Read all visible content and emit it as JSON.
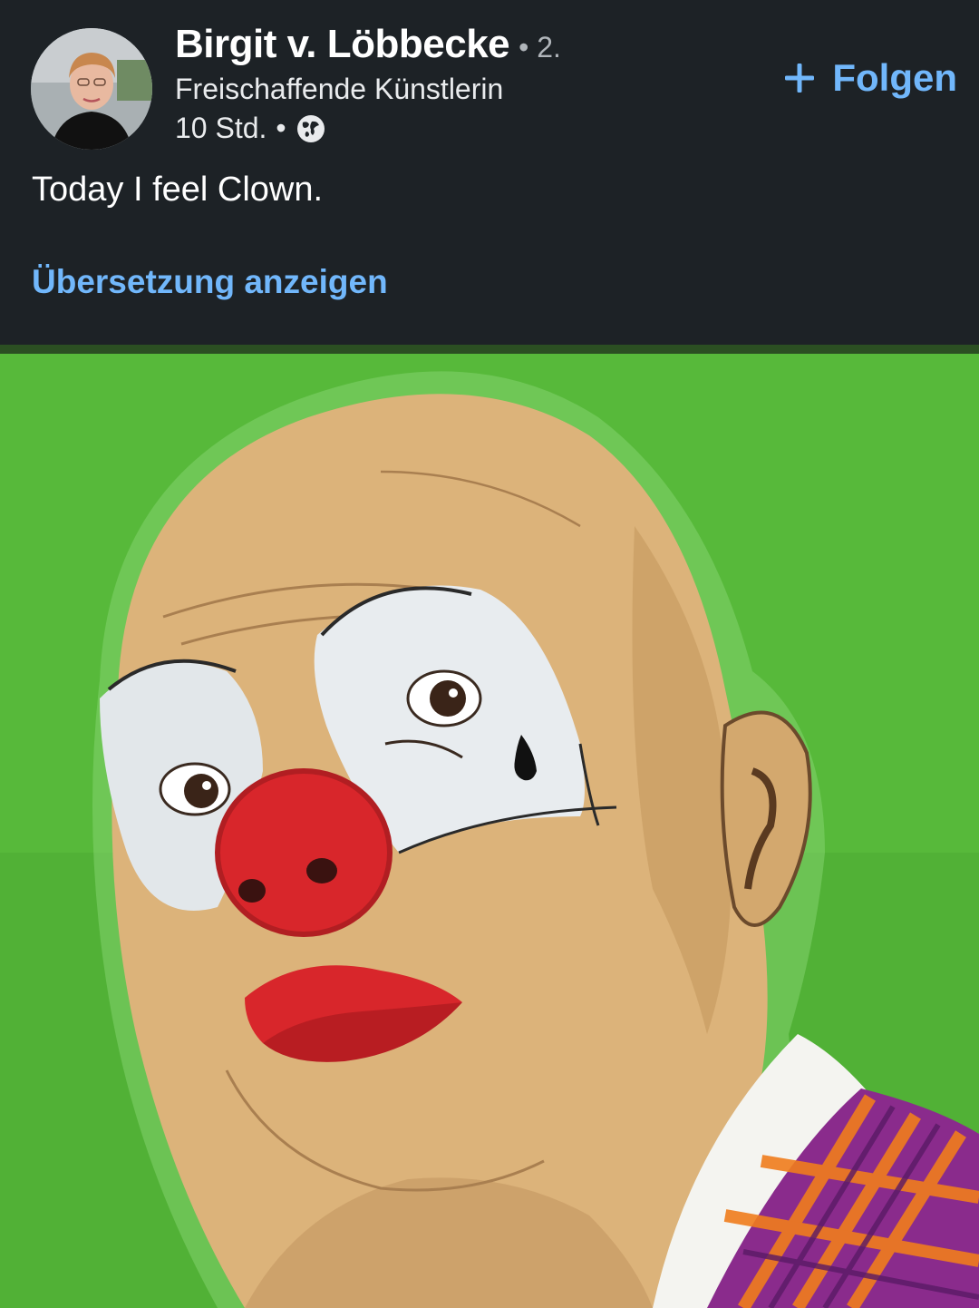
{
  "post": {
    "author": {
      "name": "Birgit v. Löbbecke",
      "connection_degree": "• 2.",
      "headline": "Freischaffende Künstlerin",
      "time": "10 Std.",
      "separator": "•",
      "visibility_icon": "globe-icon"
    },
    "follow_button": {
      "icon": "plus-icon",
      "label": "Folgen"
    },
    "text": "Today I feel Clown.",
    "translate_link": "Übersetzung anzeigen",
    "image": {
      "description": "clown-portrait-painting",
      "background_color": "#57b93a"
    }
  },
  "colors": {
    "background": "#1d2226",
    "link": "#71b7fb",
    "text": "#ffffff",
    "muted": "#b0b5ba"
  }
}
